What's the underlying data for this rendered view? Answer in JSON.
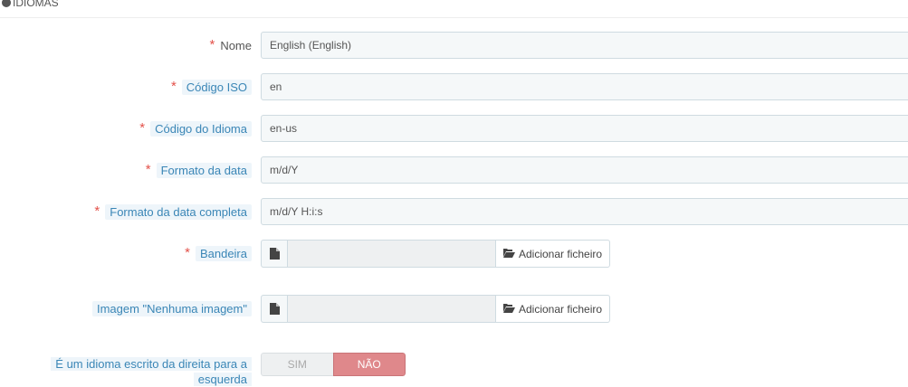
{
  "header": {
    "title": "IDIOMAS",
    "icon": "globe-icon"
  },
  "fields": [
    {
      "label": "Nome",
      "required": true,
      "value": "English (English)"
    },
    {
      "label": "Código ISO",
      "required": true,
      "value": "en"
    },
    {
      "label": "Código do Idioma",
      "required": true,
      "value": "en-us"
    },
    {
      "label": "Formato da data",
      "required": true,
      "value": "m/d/Y"
    },
    {
      "label": "Formato da data completa",
      "required": true,
      "value": "m/d/Y H:i:s"
    }
  ],
  "flag": {
    "label": "Bandeira",
    "required": true,
    "button": "Adicionar ficheiro",
    "icons": [
      "file-icon",
      "folder-open-icon"
    ]
  },
  "no_image": {
    "label": "Imagem \"Nenhuma imagem\"",
    "button": "Adicionar ficheiro"
  },
  "rtl": {
    "label_line1": "É um idioma escrito da direita para a",
    "label_line2": "esquerda",
    "yes": "SIM",
    "no": "NÃO",
    "selected": "NÃO"
  },
  "colors": {
    "required_star": "#e3524b",
    "help_label": "#3a86b6",
    "switch_no": "#df888b"
  }
}
